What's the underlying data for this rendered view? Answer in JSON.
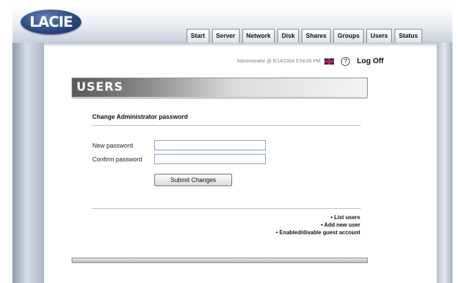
{
  "header": {
    "logo_text": "LACIE",
    "tabs": [
      "Start",
      "Server",
      "Network",
      "Disk",
      "Shares",
      "Groups",
      "Users",
      "Status"
    ]
  },
  "status": {
    "user_info": "Administrator @ 6/14/2004 5:54:00 PM",
    "flag_icon": "uk-flag-icon",
    "help_icon": "question-mark-icon",
    "logoff_label": "Log Off"
  },
  "page": {
    "banner_title": "USERS",
    "section_title": "Change Administrator password"
  },
  "form": {
    "new_password_label": "New password",
    "new_password_value": "",
    "confirm_password_label": "Confirm password",
    "confirm_password_value": "",
    "submit_label": "Submit Changes"
  },
  "links": [
    "• List users",
    "• Add new user",
    "• Enabled/disable guest account"
  ]
}
